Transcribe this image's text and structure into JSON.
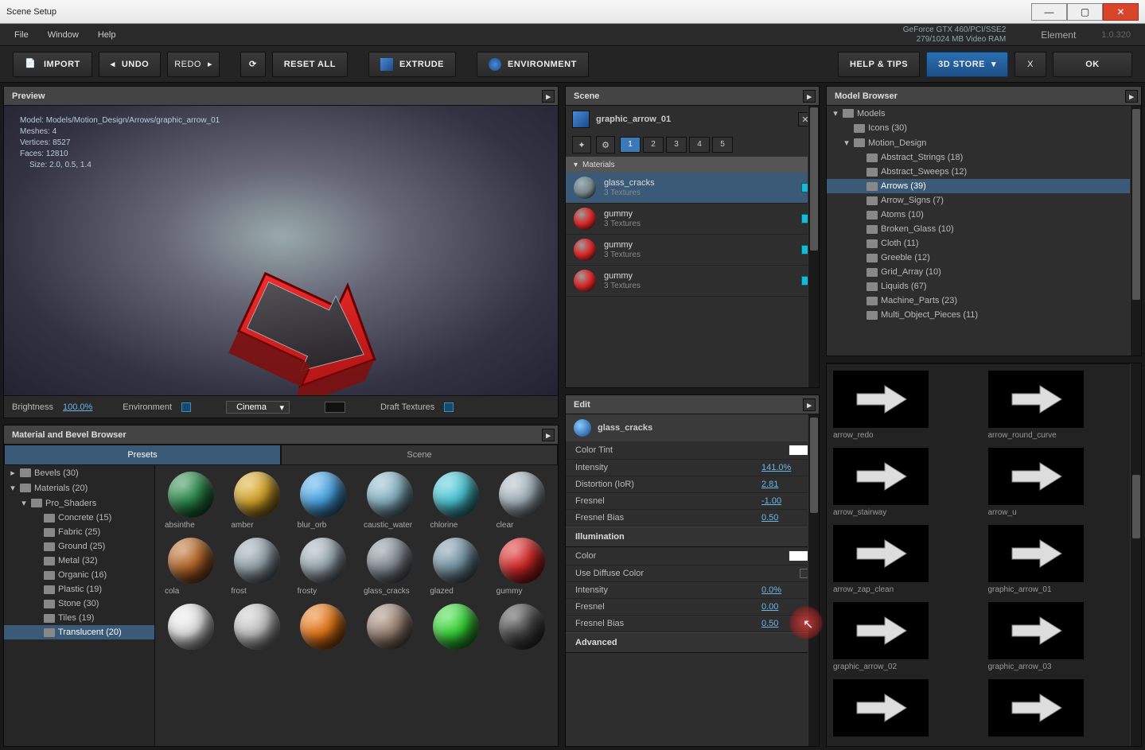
{
  "window": {
    "title": "Scene Setup"
  },
  "gpu": {
    "name": "GeForce GTX 460/PCI/SSE2",
    "vram": "279/1024 MB Video RAM"
  },
  "app": {
    "name": "Element",
    "version": "1.0.320"
  },
  "menu": {
    "file": "File",
    "window": "Window",
    "help": "Help"
  },
  "toolbar": {
    "import": "IMPORT",
    "undo": "UNDO",
    "redo": "REDO",
    "reset_all": "RESET ALL",
    "extrude": "EXTRUDE",
    "environment": "ENVIRONMENT",
    "help_tips": "HELP & TIPS",
    "store": "3D STORE",
    "x": "X",
    "ok": "OK"
  },
  "preview": {
    "title": "Preview",
    "stats": {
      "model": "Model: Models/Motion_Design/Arrows/graphic_arrow_01",
      "meshes": "Meshes: 4",
      "vertices": "Vertices: 8527",
      "faces": "Faces: 12810",
      "size": "Size: 2.0, 0.5, 1.4"
    },
    "footer": {
      "brightness_label": "Brightness",
      "brightness_val": "100.0%",
      "environment_label": "Environment",
      "render_mode": "Cinema",
      "draft_label": "Draft Textures"
    }
  },
  "matbrowser": {
    "title": "Material and Bevel Browser",
    "tabs": {
      "presets": "Presets",
      "scene": "Scene"
    },
    "tree": [
      {
        "label": "Bevels (30)",
        "ind": 0,
        "tw": "▸"
      },
      {
        "label": "Materials (20)",
        "ind": 0,
        "tw": "▾"
      },
      {
        "label": "Pro_Shaders",
        "ind": 1,
        "tw": "▾"
      },
      {
        "label": "Concrete (15)",
        "ind": 2,
        "tw": ""
      },
      {
        "label": "Fabric (25)",
        "ind": 2,
        "tw": ""
      },
      {
        "label": "Ground (25)",
        "ind": 2,
        "tw": ""
      },
      {
        "label": "Metal (32)",
        "ind": 2,
        "tw": ""
      },
      {
        "label": "Organic (16)",
        "ind": 2,
        "tw": ""
      },
      {
        "label": "Plastic (19)",
        "ind": 2,
        "tw": ""
      },
      {
        "label": "Stone (30)",
        "ind": 2,
        "tw": ""
      },
      {
        "label": "Tiles (19)",
        "ind": 2,
        "tw": ""
      },
      {
        "label": "Translucent (20)",
        "ind": 2,
        "tw": "",
        "sel": true
      }
    ],
    "spheres": [
      {
        "label": "absinthe",
        "color": "#2a8a4a"
      },
      {
        "label": "amber",
        "color": "#d8a828"
      },
      {
        "label": "blur_orb",
        "color": "#4aa8e8"
      },
      {
        "label": "caustic_water",
        "color": "#8ab8c8"
      },
      {
        "label": "chlorine",
        "color": "#4ac8d8"
      },
      {
        "label": "clear",
        "color": "#a8b8c0"
      },
      {
        "label": "cola",
        "color": "#b86828"
      },
      {
        "label": "frost",
        "color": "#98a8b0"
      },
      {
        "label": "frosty",
        "color": "#a0b0b8"
      },
      {
        "label": "glass_cracks",
        "color": "#889098"
      },
      {
        "label": "glazed",
        "color": "#7898a8"
      },
      {
        "label": "gummy",
        "color": "#d82828"
      },
      {
        "label": "",
        "color": "#e8e8e8"
      },
      {
        "label": "",
        "color": "#c8c8c8"
      },
      {
        "label": "",
        "color": "#e87818"
      },
      {
        "label": "",
        "color": "#a08878"
      },
      {
        "label": "",
        "color": "#38d838"
      },
      {
        "label": "",
        "color": "#484848"
      }
    ]
  },
  "scene": {
    "title": "Scene",
    "object": "graphic_arrow_01",
    "nums": [
      "1",
      "2",
      "3",
      "4",
      "5"
    ],
    "mat_header": "Materials",
    "materials": [
      {
        "name": "glass_cracks",
        "sub": "3 Textures",
        "color": "#788",
        "sel": true
      },
      {
        "name": "gummy",
        "sub": "3 Textures",
        "color": "#d82828"
      },
      {
        "name": "gummy",
        "sub": "3 Textures",
        "color": "#d82828"
      },
      {
        "name": "gummy",
        "sub": "3 Textures",
        "color": "#d82828"
      }
    ]
  },
  "edit": {
    "title": "Edit",
    "material": "glass_cracks",
    "section1": [
      {
        "label": "Color Tint",
        "type": "swatch"
      },
      {
        "label": "Intensity",
        "val": "141.0%"
      },
      {
        "label": "Distortion (IoR)",
        "val": "2.81"
      },
      {
        "label": "Fresnel",
        "val": "-1.00"
      },
      {
        "label": "Fresnel Bias",
        "val": "0.50"
      }
    ],
    "illum_hd": "Illumination",
    "section2": [
      {
        "label": "Color",
        "type": "swatch"
      },
      {
        "label": "Use Diffuse Color",
        "type": "check"
      },
      {
        "label": "Intensity",
        "val": "0.0%"
      },
      {
        "label": "Fresnel",
        "val": "0.00"
      },
      {
        "label": "Fresnel Bias",
        "val": "0.50"
      }
    ],
    "adv_hd": "Advanced"
  },
  "modelbrowser": {
    "title": "Model Browser",
    "tree": [
      {
        "label": "Models",
        "ind": 0,
        "tw": "▾"
      },
      {
        "label": "Icons (30)",
        "ind": 1,
        "tw": ""
      },
      {
        "label": "Motion_Design",
        "ind": 1,
        "tw": "▾"
      },
      {
        "label": "Abstract_Strings (18)",
        "ind": 2,
        "tw": ""
      },
      {
        "label": "Abstract_Sweeps (12)",
        "ind": 2,
        "tw": ""
      },
      {
        "label": "Arrows (39)",
        "ind": 2,
        "tw": "",
        "sel": true
      },
      {
        "label": "Arrow_Signs (7)",
        "ind": 2,
        "tw": ""
      },
      {
        "label": "Atoms (10)",
        "ind": 2,
        "tw": ""
      },
      {
        "label": "Broken_Glass (10)",
        "ind": 2,
        "tw": ""
      },
      {
        "label": "Cloth (11)",
        "ind": 2,
        "tw": ""
      },
      {
        "label": "Greeble (12)",
        "ind": 2,
        "tw": ""
      },
      {
        "label": "Grid_Array (10)",
        "ind": 2,
        "tw": ""
      },
      {
        "label": "Liquids (67)",
        "ind": 2,
        "tw": ""
      },
      {
        "label": "Machine_Parts (23)",
        "ind": 2,
        "tw": ""
      },
      {
        "label": "Multi_Object_Pieces (11)",
        "ind": 2,
        "tw": ""
      }
    ],
    "thumbs": [
      {
        "label": "arrow_redo"
      },
      {
        "label": "arrow_round_curve"
      },
      {
        "label": "arrow_stairway"
      },
      {
        "label": "arrow_u"
      },
      {
        "label": "arrow_zap_clean"
      },
      {
        "label": "graphic_arrow_01"
      },
      {
        "label": "graphic_arrow_02"
      },
      {
        "label": "graphic_arrow_03"
      },
      {
        "label": ""
      },
      {
        "label": ""
      }
    ]
  }
}
